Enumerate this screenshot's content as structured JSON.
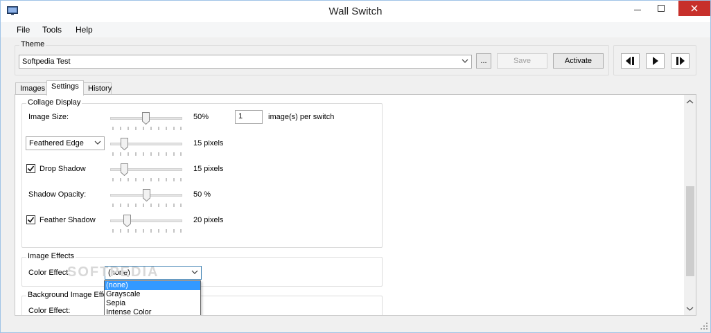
{
  "window": {
    "title": "Wall Switch"
  },
  "menu": [
    "File",
    "Tools",
    "Help"
  ],
  "theme": {
    "label": "Theme",
    "selected": "Softpedia Test",
    "browse_label": "...",
    "save_label": "Save",
    "activate_label": "Activate"
  },
  "tabs": [
    "Images",
    "Settings",
    "History"
  ],
  "collage": {
    "label": "Collage Display",
    "image_size_label": "Image Size:",
    "image_size_value": "50%",
    "per_switch_count": "1",
    "per_switch_label": "image(s) per switch",
    "edge_mode": "Feathered Edge",
    "edge_value": "15 pixels",
    "drop_shadow_label": "Drop Shadow",
    "drop_shadow_checked": true,
    "drop_shadow_value": "15 pixels",
    "shadow_opacity_label": "Shadow Opacity:",
    "shadow_opacity_value": "50 %",
    "feather_shadow_label": "Feather Shadow",
    "feather_shadow_checked": true,
    "feather_shadow_value": "20 pixels",
    "slider_fractions": [
      0.5,
      0.15,
      0.15,
      0.5,
      0.2
    ]
  },
  "image_effects": {
    "label": "Image Effects",
    "color_effect_label": "Color Effect:",
    "color_effect_selected": "(none)",
    "options": [
      "(none)",
      "Grayscale",
      "Sepia",
      "Intense Color"
    ]
  },
  "background_effects": {
    "label": "Background Image Effe",
    "color_effect_label": "Color Effect:"
  },
  "watermark": "SOFTPEDIA"
}
